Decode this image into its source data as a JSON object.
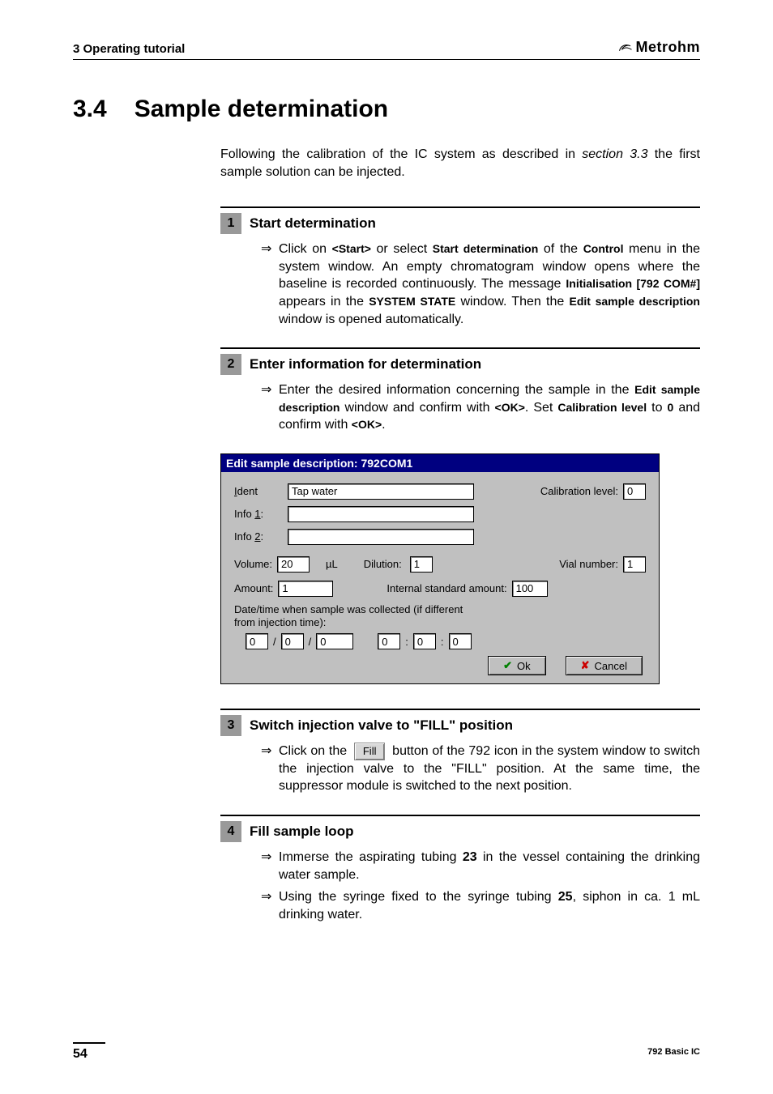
{
  "header": {
    "chapter": "3 Operating tutorial",
    "brand": "Metrohm"
  },
  "section": {
    "number": "3.4",
    "title": "Sample determination"
  },
  "intro": {
    "text_before": "Following the calibration of the IC system as described in ",
    "ref": "section 3.3",
    "text_after": " the first sample solution can be injected."
  },
  "steps": [
    {
      "num": "1",
      "title": "Start determination",
      "items": [
        {
          "parts": [
            {
              "t": "Click on "
            },
            {
              "t": "<Start>",
              "b": true
            },
            {
              "t": " or select "
            },
            {
              "t": "Start determination",
              "b": true
            },
            {
              "t": " of the "
            },
            {
              "t": "Control",
              "b": true
            },
            {
              "t": " menu in the system window. An empty chromatogram window opens where the baseline is recorded continuously. The message "
            },
            {
              "t": "Initialisation [792 COM#]",
              "b": true
            },
            {
              "t": " appears in the "
            },
            {
              "t": "SYSTEM STATE",
              "b": true
            },
            {
              "t": " window. Then the "
            },
            {
              "t": "Edit sample description",
              "b": true
            },
            {
              "t": " window is opened automatically."
            }
          ]
        }
      ]
    },
    {
      "num": "2",
      "title": "Enter information for determination",
      "items": [
        {
          "parts": [
            {
              "t": "Enter the desired information concerning the sample in the "
            },
            {
              "t": "Edit sample description",
              "b": true
            },
            {
              "t": " window and confirm with "
            },
            {
              "t": "<OK>",
              "b": true
            },
            {
              "t": ". Set "
            },
            {
              "t": "Calibration level",
              "b": true
            },
            {
              "t": " to "
            },
            {
              "t": "0",
              "b": true
            },
            {
              "t": " and confirm with "
            },
            {
              "t": "<OK>",
              "b": true
            },
            {
              "t": "."
            }
          ]
        }
      ]
    },
    {
      "num": "3",
      "title": "Switch injection valve to \"FILL\" position",
      "items": [
        {
          "parts": [
            {
              "t": "Click on the "
            },
            {
              "btn": "Fill"
            },
            {
              "t": " button of the 792 icon in the system window to switch the injection valve to the \"FILL\" position. At the same time, the suppressor module is switched to the next position."
            }
          ]
        }
      ]
    },
    {
      "num": "4",
      "title": "Fill sample loop",
      "items": [
        {
          "parts": [
            {
              "t": "Immerse the aspirating tubing "
            },
            {
              "t": "23",
              "bn": true
            },
            {
              "t": " in the vessel containing the drinking water sample."
            }
          ]
        },
        {
          "parts": [
            {
              "t": "Using the syringe fixed to the syringe tubing "
            },
            {
              "t": "25",
              "bn": true
            },
            {
              "t": ", siphon in ca. 1 mL drinking water."
            }
          ]
        }
      ]
    }
  ],
  "dialog": {
    "title": "Edit sample description: 792COM1",
    "labels": {
      "ident": "Ident",
      "info1": "Info 1:",
      "info2": "Info 2:",
      "cal_level": "Calibration level:",
      "volume": "Volume:",
      "unit_ul": "µL",
      "dilution": "Dilution:",
      "vial": "Vial number:",
      "amount": "Amount:",
      "isa": "Internal standard amount:",
      "dt_caption": "Date/time when sample was collected (if different from injection time):",
      "ok": "Ok",
      "cancel": "Cancel"
    },
    "values": {
      "ident": "Tap water",
      "info1": "",
      "info2": "",
      "cal_level": "0",
      "volume": "20",
      "dilution": "1",
      "vial": "1",
      "amount": "1",
      "isa": "100",
      "d1": "0",
      "d2": "0",
      "d3": "0",
      "t1": "0",
      "t2": "0",
      "t3": "0"
    }
  },
  "footer": {
    "page": "54",
    "doc": "792 Basic IC"
  }
}
